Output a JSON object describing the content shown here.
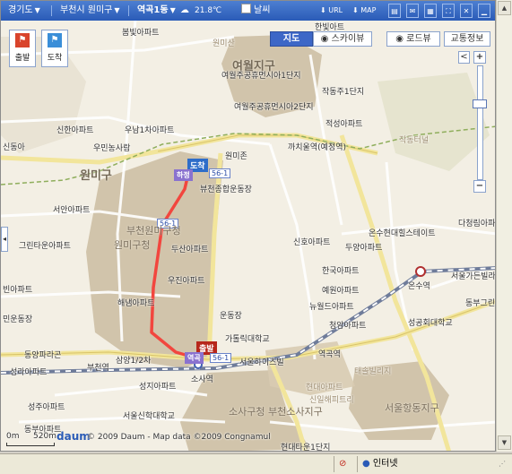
{
  "topbar": {
    "province": "경기도",
    "city": "부천시 원미구",
    "dong": "역곡1동",
    "temperature": "21.8℃",
    "weather_check_label": "날씨",
    "url_button": "URL",
    "map_button": "MAP"
  },
  "left_buttons": {
    "start": "출발",
    "arrive": "도착"
  },
  "view_tabs": {
    "map": "지도",
    "skyview": "스카이뷰",
    "roadview": "로드뷰",
    "traffic": "교통정보"
  },
  "zoom": {
    "plus": "+",
    "minus": "−",
    "arrow_left": "<"
  },
  "colors": {
    "route": "#f2463e",
    "topbar": "#2a5bb7",
    "residential": "#c9b79a"
  },
  "route_markers": {
    "arrive": "도착",
    "start": "출발",
    "bus_top": "56-1",
    "bus_mid": "56-1",
    "bus_bottom": "56-1",
    "stop_top": "하정",
    "stop_bottom": "역곡"
  },
  "labels": [
    "봄빛아파트",
    "한빛아트",
    "원미산",
    "여월지구",
    "여월주공휴먼시아1단지",
    "작동주1단지",
    "여월주공휴먼시아2단지",
    "적성아파트",
    "신한아파트",
    "우남1차아파트",
    "우민농사람",
    "원미존",
    "까치울역(예정역)",
    "작동터널",
    "신동아",
    "원미구",
    "뷰천종합운동장",
    "서안아파트",
    "부천원미구청",
    "원미구청",
    "그린타운아파트",
    "두산아파트",
    "신호아파트",
    "온수현대힐스테이트",
    "두양아파트",
    "다청림아파트",
    "빈아파트",
    "우진아파트",
    "한국아파트",
    "예원아파트",
    "온수역",
    "서울가든빌라",
    "민운동장",
    "해냄아파트",
    "운동장",
    "뉴월드아파트",
    "동부그린",
    "청암아파트",
    "가톨릭대학교",
    "성공회대학교",
    "동양파라곤",
    "삼양1/2차",
    "부천역",
    "서울하이츠빌",
    "역곡역",
    "태솔빌리지",
    "성라아파트",
    "성지아파트",
    "소사역",
    "현대아파트",
    "신일해피트리",
    "성주아파트",
    "서울신학대학교",
    "소사구청",
    "부천소사지구",
    "서울항동지구",
    "동부아파트",
    "현대타운1단지"
  ],
  "attribution": {
    "scale_left": "0m",
    "scale_right": "520m",
    "brand": "daum",
    "copyright": "© 2009 Daum - Map data ©2009 Congnamul"
  },
  "statusbar": {
    "zone": "인터넷"
  }
}
